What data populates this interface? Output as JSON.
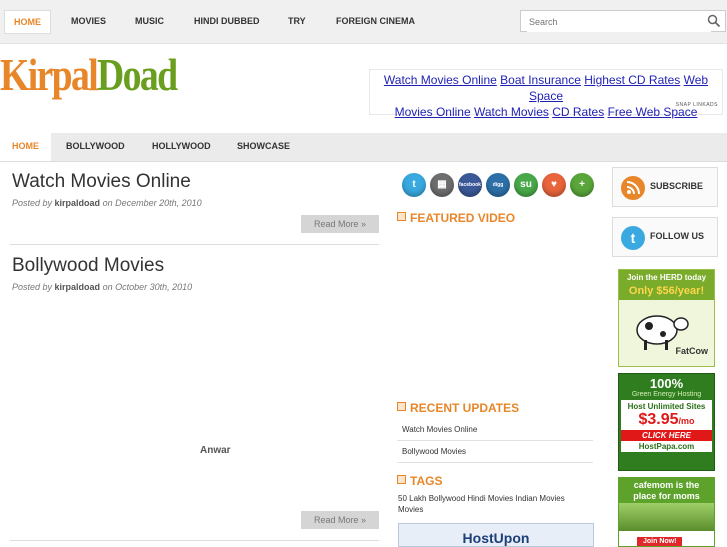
{
  "topnav": {
    "items": [
      {
        "label": "Home",
        "active": true
      },
      {
        "label": "Movies"
      },
      {
        "label": "Music"
      },
      {
        "label": "Hindi Dubbed"
      },
      {
        "label": "TRY"
      },
      {
        "label": "Foreign Cinema"
      }
    ],
    "search_placeholder": "Search"
  },
  "logo": {
    "part1": "Kirpal",
    "part2": "Doad"
  },
  "ads": {
    "line1": [
      "Watch Movies Online",
      "Boat Insurance",
      "Highest CD Rates",
      "Web Space"
    ],
    "line2": [
      "Movies Online",
      "Watch Movies",
      "CD Rates",
      "Free Web Space"
    ],
    "credit": "SNAP LINKADS"
  },
  "subnav": {
    "items": [
      {
        "label": "Home",
        "active": true
      },
      {
        "label": "Bollywood"
      },
      {
        "label": "Hollywood"
      },
      {
        "label": "Showcase"
      }
    ]
  },
  "posts": [
    {
      "title": "Watch Movies Online",
      "posted_by": "Posted by",
      "author": "kirpaldoad",
      "date": "on December 20th, 2010",
      "read_more": "Read More »"
    },
    {
      "title": "Bollywood Movies",
      "posted_by": "Posted by",
      "author": "kirpaldoad",
      "date": "on October 30th, 2010",
      "read_more": "Read More »",
      "body": "Anwar"
    }
  ],
  "social": [
    {
      "name": "twitter-icon",
      "glyph": "t",
      "color": "#39a9e0"
    },
    {
      "name": "delicious-icon",
      "glyph": "▦",
      "color": "#6e6e6e"
    },
    {
      "name": "facebook-icon",
      "glyph": "facebook",
      "color": "#3b5998"
    },
    {
      "name": "digg-icon",
      "glyph": "digg",
      "color": "#2d6fa8"
    },
    {
      "name": "stumbleupon-icon",
      "glyph": "su",
      "color": "#49a94a"
    },
    {
      "name": "favorite-icon",
      "glyph": "♥",
      "color": "#e9653c"
    },
    {
      "name": "add-icon",
      "glyph": "+",
      "color": "#5aa63a"
    }
  ],
  "featured_video": {
    "heading": "FEATURED VIDEO"
  },
  "recent_updates": {
    "heading": "RECENT UPDATES",
    "items": [
      "Watch Movies Online",
      "Bollywood Movies"
    ]
  },
  "tags": {
    "heading": "TAGS",
    "text": "50 Lakh Bollywood Hindi Movies Indian Movies Movies"
  },
  "host_ad": {
    "text": "HostUpon"
  },
  "sidebar": {
    "subscribe": "SUBSCRIBE",
    "follow": "FOLLOW US",
    "fatcow": {
      "line1": "Join the HERD today",
      "line2": "Only $56/year!",
      "brand": "FatCow"
    },
    "hostpapa": {
      "line1": "100%",
      "line2": "Green Energy Hosting",
      "line3": "Host Unlimited Sites",
      "price": "$3.95",
      "per": "/mo",
      "cta": "CLICK HERE",
      "brand": "HostPapa.com"
    },
    "cafemom": {
      "line1": "cafemom is the",
      "line2": "place for moms",
      "cta": "Join Now!"
    }
  },
  "colors": {
    "accent": "#e8872a",
    "logo_green": "#6a9e1f",
    "link": "#1f1fb5"
  }
}
